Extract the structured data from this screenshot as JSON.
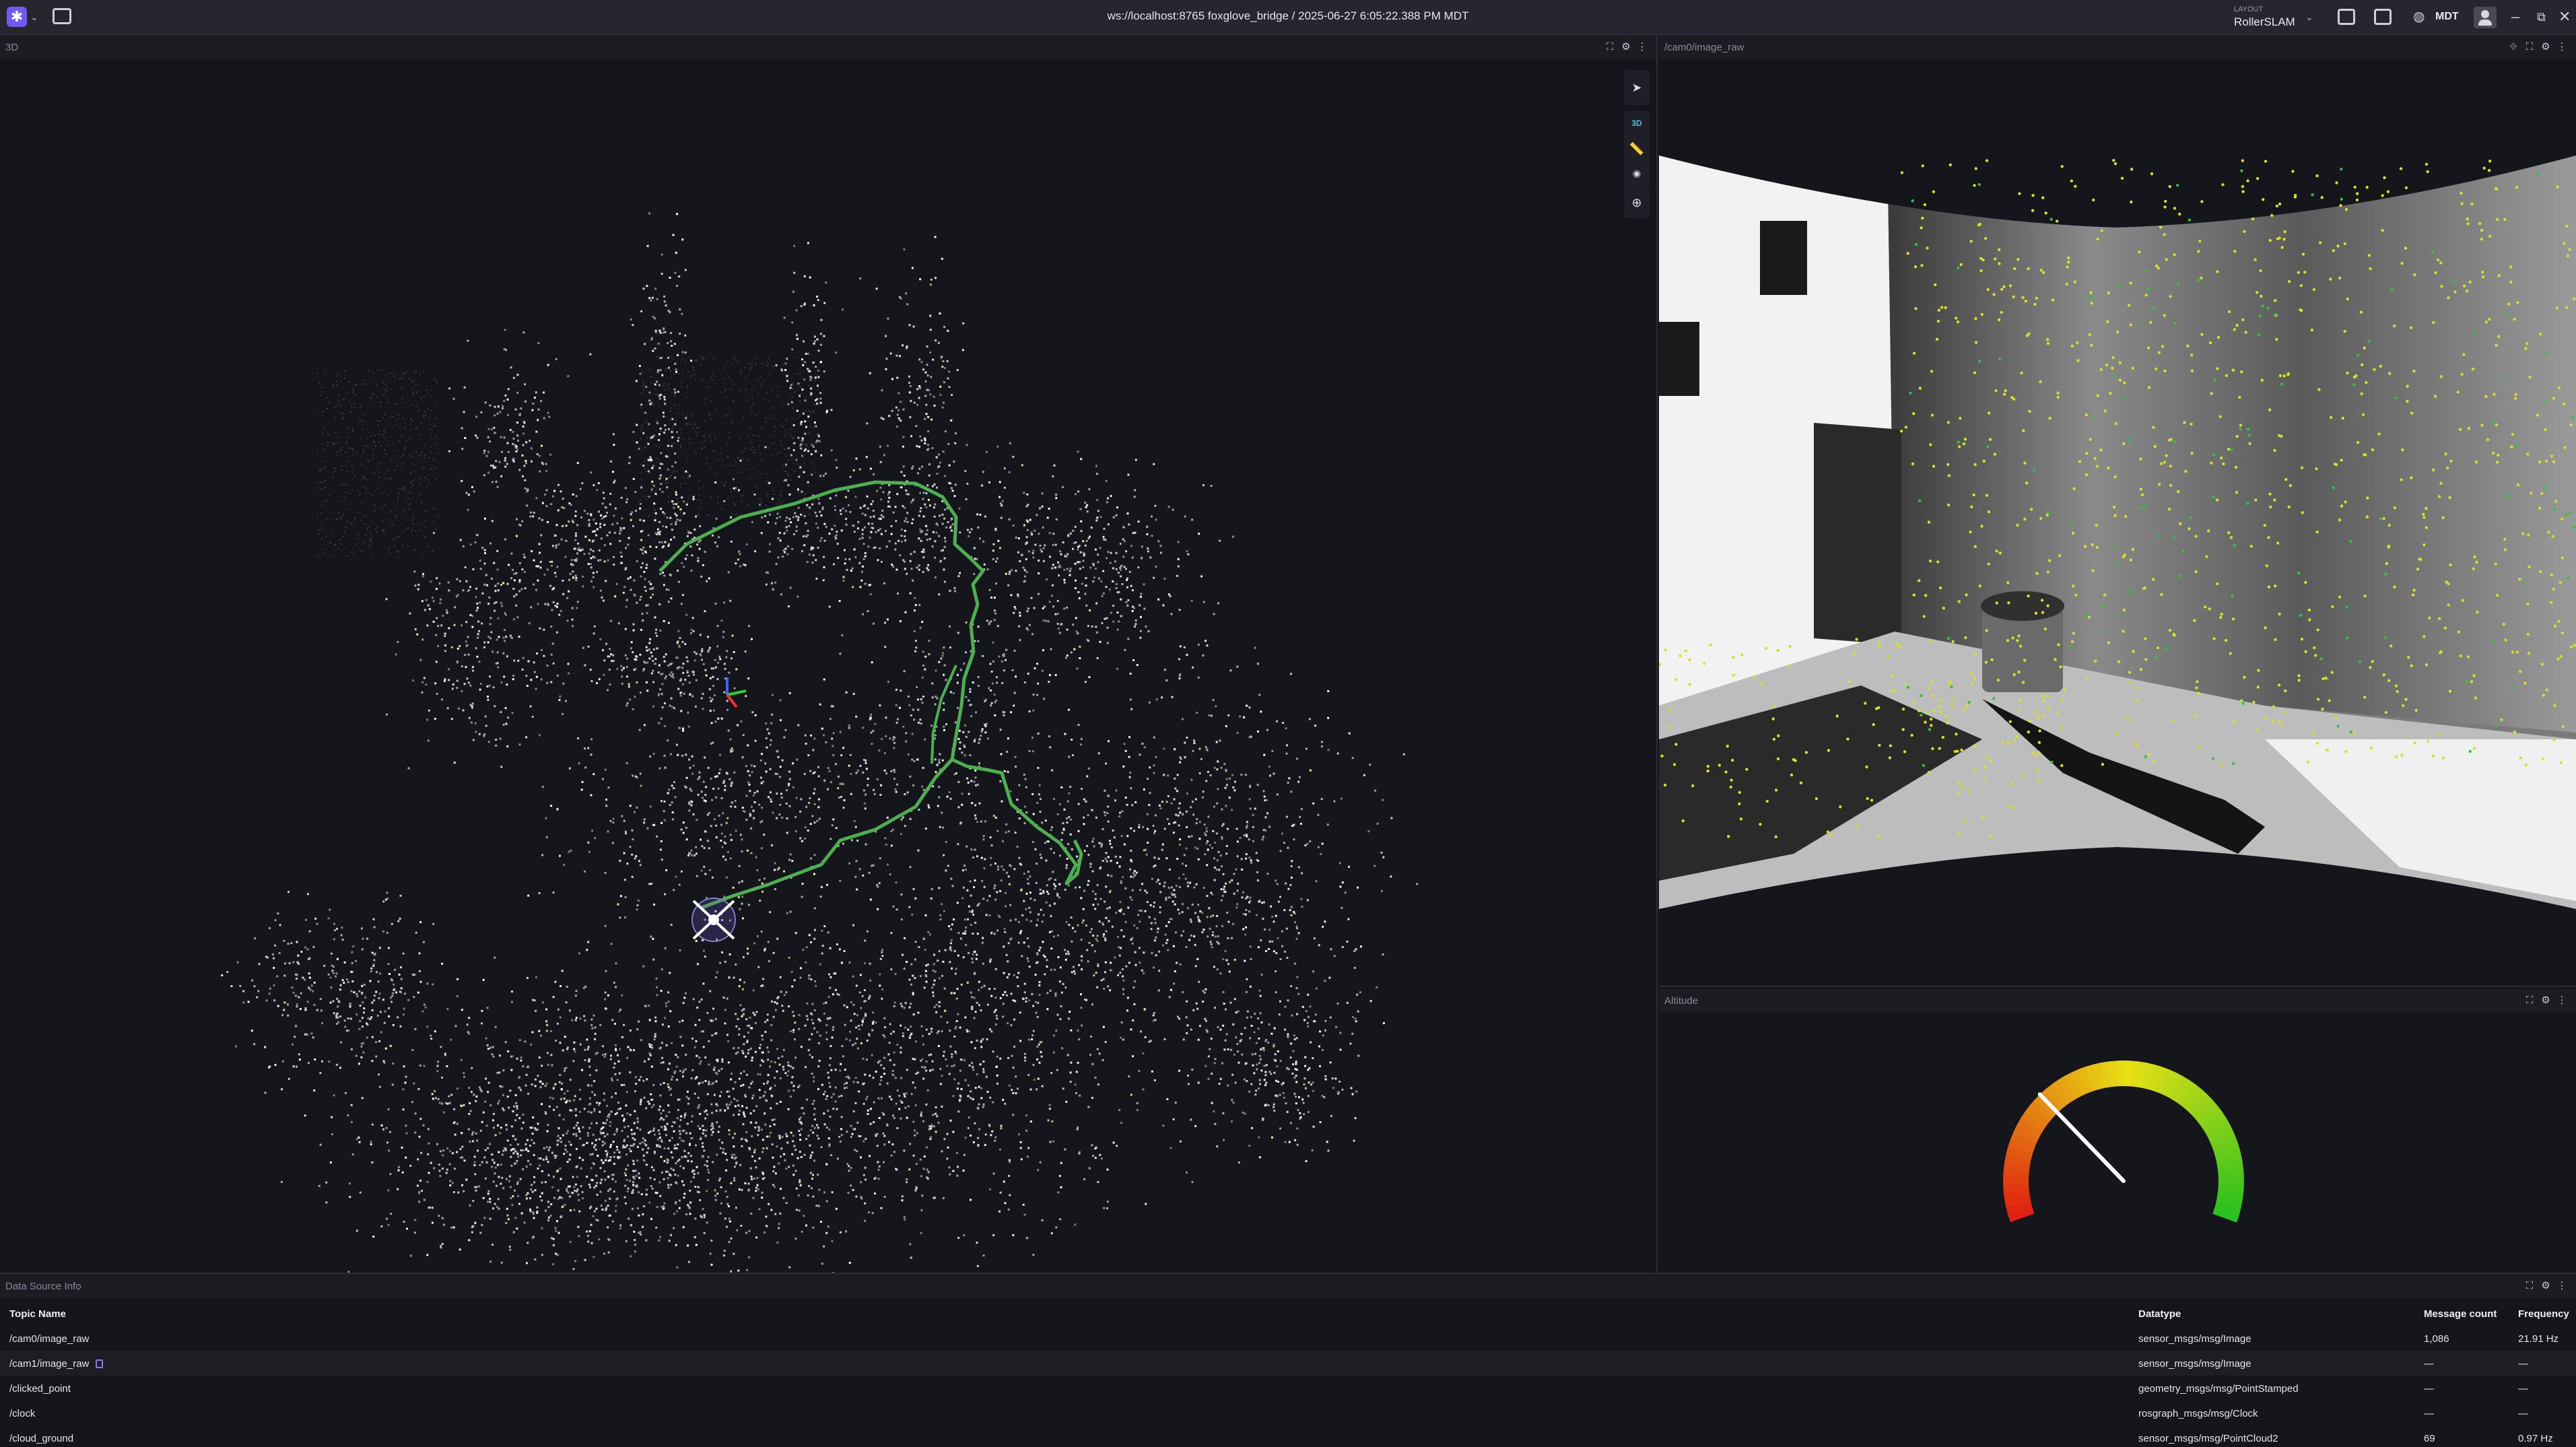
{
  "appbar": {
    "connection_title": "ws://localhost:8765 foxglove_bridge / 2025-06-27 6:05:22.388 PM MDT",
    "layout_caption": "LAYOUT",
    "layout_name": "RollerSLAM",
    "timezone": "MDT"
  },
  "panels": {
    "three_d": {
      "title": "3D",
      "mode_label": "3D"
    },
    "image": {
      "title": "/cam0/image_raw"
    },
    "gauge": {
      "title": "Altitude",
      "needle_fraction": 0.3
    },
    "data_source_info": {
      "title": "Data Source Info"
    }
  },
  "dsi_table": {
    "headers": {
      "topic": "Topic Name",
      "datatype": "Datatype",
      "count": "Message count",
      "frequency": "Frequency"
    },
    "rows": [
      {
        "topic": "/cam0/image_raw",
        "datatype": "sensor_msgs/msg/Image",
        "count": "1,086",
        "frequency": "21.91 Hz",
        "copy": false
      },
      {
        "topic": "/cam1/image_raw",
        "datatype": "sensor_msgs/msg/Image",
        "count": "—",
        "frequency": "—",
        "copy": true
      },
      {
        "topic": "/clicked_point",
        "datatype": "geometry_msgs/msg/PointStamped",
        "count": "—",
        "frequency": "—",
        "copy": false
      },
      {
        "topic": "/clock",
        "datatype": "rosgraph_msgs/msg/Clock",
        "count": "—",
        "frequency": "—",
        "copy": false
      },
      {
        "topic": "/cloud_ground",
        "datatype": "sensor_msgs/msg/PointCloud2",
        "count": "69",
        "frequency": "0.97 Hz",
        "copy": false
      }
    ]
  },
  "colors": {
    "accent": "#6f5af6",
    "trajectory": "#4caf50",
    "feature_points": "#d6e024",
    "gauge_low": "#e02010",
    "gauge_high": "#22c020"
  }
}
